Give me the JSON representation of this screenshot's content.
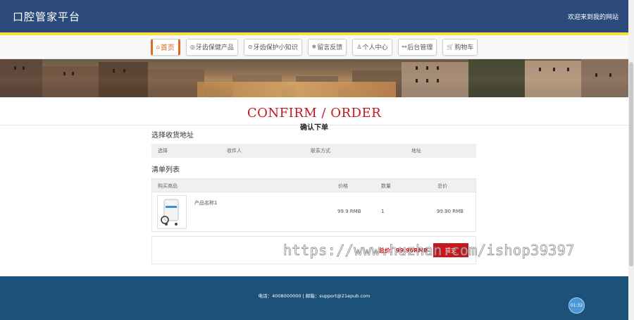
{
  "header": {
    "brand": "口腔管家平台",
    "welcome": "欢迎来到我的网站"
  },
  "nav": [
    {
      "label": "首页",
      "icon": "⌂",
      "icon_name": "home-icon"
    },
    {
      "label": "牙齿保健产品",
      "icon": "◎",
      "icon_name": "product-icon"
    },
    {
      "label": "牙齿保护小知识",
      "icon": "⊙",
      "icon_name": "knowledge-icon"
    },
    {
      "label": "留言反馈",
      "icon": "❄",
      "icon_name": "feedback-icon"
    },
    {
      "label": "个人中心",
      "icon": "♙",
      "icon_name": "user-icon"
    },
    {
      "label": "后台管理",
      "icon": "⚯",
      "icon_name": "link-icon"
    },
    {
      "label": "购物车",
      "icon": "🛒",
      "icon_name": "cart-icon"
    }
  ],
  "page": {
    "title_en": "CONFIRM / ORDER",
    "title_cn": "确认下单"
  },
  "address": {
    "section_title": "选择收货地址",
    "columns": [
      "选择",
      "收件人",
      "联系方式",
      "地址"
    ]
  },
  "order": {
    "section_title": "清单列表",
    "columns": [
      "购买商品",
      "价格",
      "数量",
      "总价"
    ],
    "rows": [
      {
        "name": "产品名称1",
        "price": "99.9 RMB",
        "qty": "1",
        "total": "99.90 RMB"
      }
    ],
    "total_label": "总价：99.90RMB",
    "submit_label": "提交"
  },
  "footer": {
    "text": "电话：4008000000 | 邮箱：support@21epub.com"
  },
  "chat": {
    "label": "01:32"
  },
  "watermark": "https://www.huzhan.com/ishop39397",
  "colors": {
    "header": "#2d4a7c",
    "accent_red": "#c8161d",
    "footer": "#1c5279",
    "nav_active": "#e06a2a"
  }
}
